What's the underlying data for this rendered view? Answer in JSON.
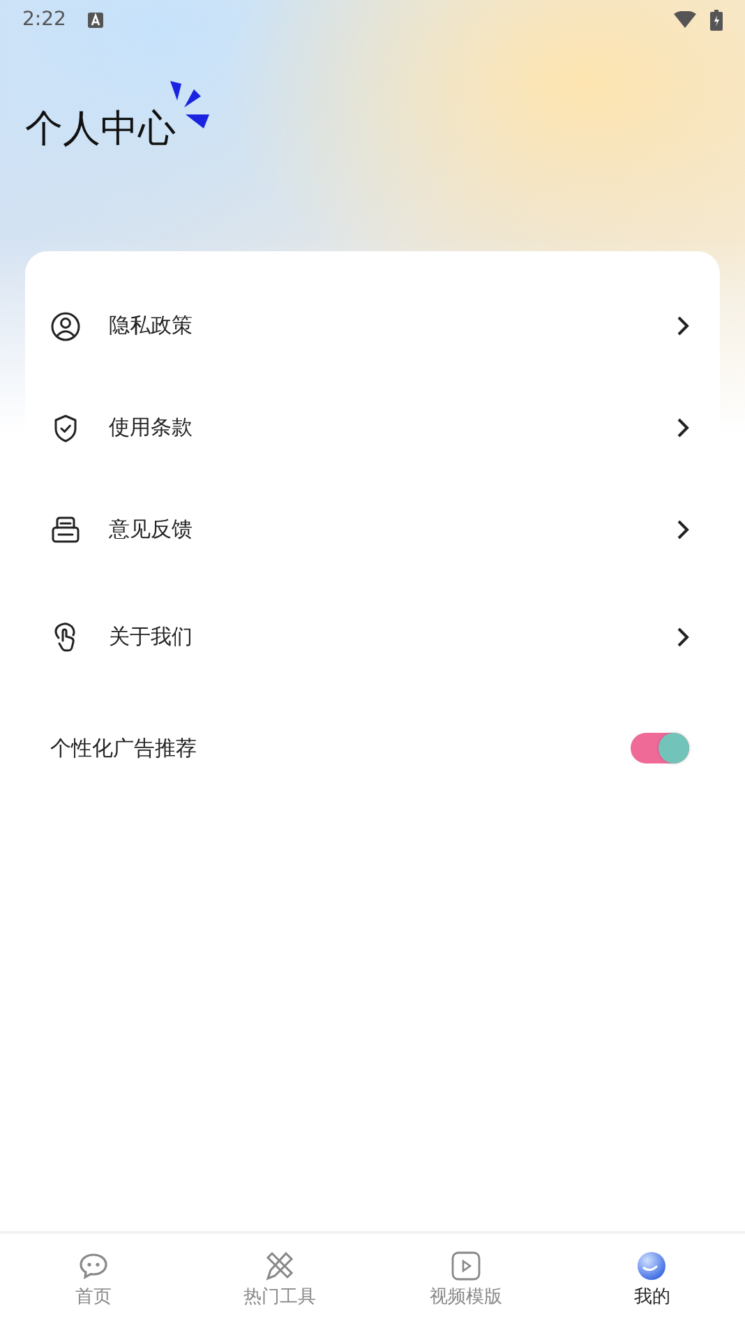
{
  "status_bar": {
    "time": "2:22"
  },
  "title": "个人中心",
  "menu": [
    {
      "label": "隐私政策",
      "kind": "person"
    },
    {
      "label": "使用条款",
      "kind": "shield"
    },
    {
      "label": "意见反馈",
      "kind": "tray"
    },
    {
      "label": "关于我们",
      "kind": "hand"
    }
  ],
  "setting": {
    "label": "个性化广告推荐",
    "on": true
  },
  "tabs": [
    {
      "label": "首页",
      "kind": "chat",
      "selected": false
    },
    {
      "label": "热门工具",
      "kind": "tools",
      "selected": false
    },
    {
      "label": "视频模版",
      "kind": "play",
      "selected": false
    },
    {
      "label": "我的",
      "kind": "me",
      "selected": true
    }
  ]
}
